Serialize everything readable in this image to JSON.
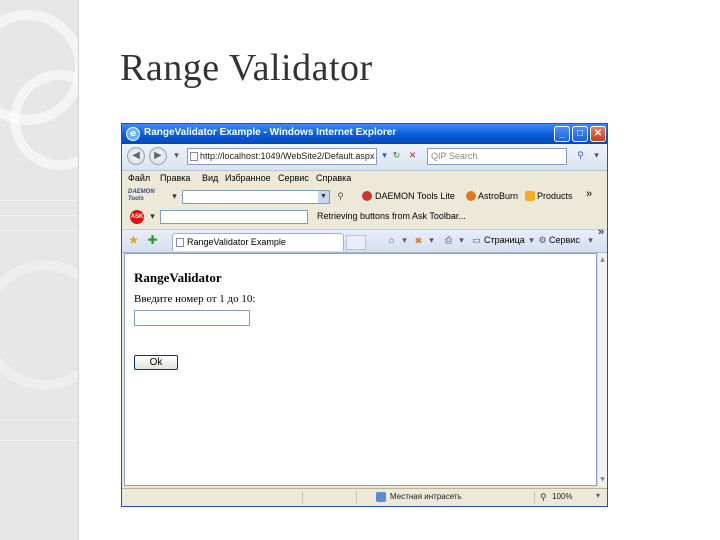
{
  "slide": {
    "title": "Range Validator"
  },
  "window": {
    "title": "RangeValidator Example - Windows Internet Explorer",
    "minimize": "_",
    "maximize": "□",
    "close": "✕"
  },
  "address_bar": {
    "url": "http://localhost:1049/WebSite2/Default.aspx",
    "search_placeholder": "QIP Search",
    "back_icon": "arrow-left-icon",
    "forward_icon": "arrow-right-icon"
  },
  "menu": [
    "Файл",
    "Правка",
    "Вид",
    "Избранное",
    "Сервис",
    "Справка"
  ],
  "toolbar_daemon": {
    "logo": "DAEMON Tools",
    "items": [
      "DAEMON Tools Lite",
      "AstroBurn",
      "Products"
    ],
    "chevron": "»"
  },
  "toolbar_ask": {
    "logo": "ASK",
    "status_text": "Retrieving buttons from Ask Toolbar..."
  },
  "tabs": {
    "active_tab": "RangeValidator Example",
    "page_menu": "Страница",
    "tools_menu": "Сервис",
    "chevron": "»"
  },
  "page": {
    "heading": "RangeValidator",
    "prompt": "Введите номер от 1 до 10:",
    "input_value": "",
    "ok_button": "Ok"
  },
  "status_bar": {
    "zone": "Местная интрасеть",
    "zoom": "100%"
  },
  "colors": {
    "titlebar": "#0a5bd6",
    "chrome": "#ece9d8",
    "slide_band": "#e6e6e6"
  }
}
